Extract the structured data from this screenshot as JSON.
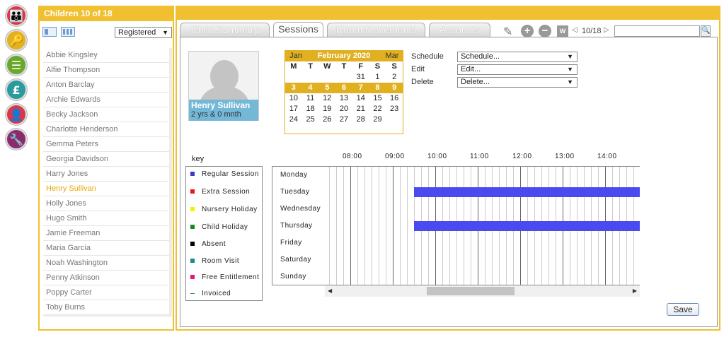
{
  "sidebar_nav": [
    {
      "name": "children-nav",
      "color": "#d6394a",
      "glyph": "👪"
    },
    {
      "name": "sessions-nav",
      "color": "#e2b21c",
      "glyph": "🔑"
    },
    {
      "name": "documents-nav",
      "color": "#6aa82a",
      "glyph": "☰"
    },
    {
      "name": "finance-nav",
      "color": "#2a9a9e",
      "glyph": "£"
    },
    {
      "name": "staff-nav",
      "color": "#d6394a",
      "glyph": "👤"
    },
    {
      "name": "settings-nav",
      "color": "#8c2a6e",
      "glyph": "🔧"
    }
  ],
  "left": {
    "title": "Children 10 of 18",
    "filter": "Registered",
    "children": [
      "Abbie Kingsley",
      "Alfie Thompson",
      "Anton Barclay",
      "Archie Edwards",
      "Becky Jackson",
      "Charlotte Henderson",
      "Gemma Peters",
      "Georgia Davidson",
      "Harry Jones",
      "Henry Sullivan",
      "Holly Jones",
      "Hugo Smith",
      "Jamie Freeman",
      "Maria Garcia",
      "Noah Washington",
      "Penny Atkinson",
      "Poppy Carter",
      "Toby Burns"
    ],
    "selected": "Henry Sullivan"
  },
  "tabs": [
    "Child Summary",
    "Sessions",
    "Room Movements",
    "Accounts"
  ],
  "active_tab": "Sessions",
  "toolbar": {
    "counter": "10/18",
    "search_value": ""
  },
  "profile": {
    "name": "Henry Sullivan",
    "age": "2 yrs & 0 mnth"
  },
  "calendar": {
    "prev": "Jan",
    "month": "February 2020",
    "next": "Mar",
    "weekdays": [
      "M",
      "T",
      "W",
      "T",
      "F",
      "S",
      "S"
    ],
    "weeks": [
      [
        "",
        "",
        "",
        "",
        "31",
        "1",
        "2"
      ],
      [
        "3",
        "4",
        "5",
        "6",
        "7",
        "8",
        "9"
      ],
      [
        "10",
        "11",
        "12",
        "13",
        "14",
        "15",
        "16"
      ],
      [
        "17",
        "18",
        "19",
        "20",
        "21",
        "22",
        "23"
      ],
      [
        "24",
        "25",
        "26",
        "27",
        "28",
        "29",
        ""
      ]
    ],
    "highlight_week": 1
  },
  "actions": [
    {
      "label": "Schedule",
      "value": "Schedule..."
    },
    {
      "label": "Edit",
      "value": "Edit..."
    },
    {
      "label": "Delete",
      "value": "Delete..."
    }
  ],
  "key": {
    "title": "key",
    "items": [
      {
        "label": "Regular Session",
        "color": "#3a3ac8"
      },
      {
        "label": "Extra Session",
        "color": "#e8141e"
      },
      {
        "label": "Nursery Holiday",
        "color": "#f0f000"
      },
      {
        "label": "Child Holiday",
        "color": "#1a8a1a"
      },
      {
        "label": "Absent",
        "color": "#000000"
      },
      {
        "label": "Room Visit",
        "color": "#1a8a8a"
      },
      {
        "label": "Free Entitlement",
        "color": "#e8147a"
      },
      {
        "label": "Invoiced",
        "color": "#1a8a8a"
      }
    ]
  },
  "schedule": {
    "hours": [
      "08:00",
      "09:00",
      "10:00",
      "11:00",
      "12:00",
      "13:00",
      "14:00"
    ],
    "days": [
      "Monday",
      "Tuesday",
      "Wednesday",
      "Thursday",
      "Friday",
      "Saturday",
      "Sunday"
    ],
    "sessions": [
      {
        "day": "Tuesday",
        "start": "09:30",
        "end": "end of visible range"
      },
      {
        "day": "Thursday",
        "start": "09:30",
        "end": "end of visible range"
      }
    ],
    "session_color": "#4a4af0"
  },
  "save_label": "Save"
}
